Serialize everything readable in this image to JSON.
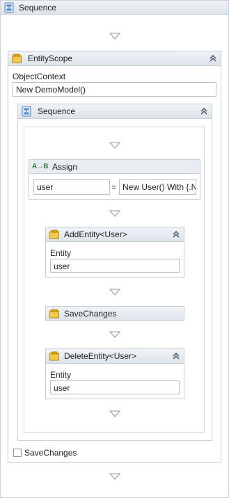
{
  "root": {
    "title": "Sequence",
    "icon": "sequence-icon"
  },
  "entity_scope": {
    "title": "EntityScope",
    "icon": "scope-icon",
    "object_context_label": "ObjectContext",
    "object_context_value": "New DemoModel()",
    "footer_checkbox_label": "SaveChanges"
  },
  "inner_sequence": {
    "title": "Sequence",
    "icon": "sequence-icon"
  },
  "assign": {
    "title": "Assign",
    "icon": "assign-icon",
    "to": "user",
    "equals": "=",
    "value": "New User() With {.N"
  },
  "add_entity": {
    "title": "AddEntity<User>",
    "entity_label": "Entity",
    "entity_value": "user"
  },
  "save_changes": {
    "title": "SaveChanges"
  },
  "delete_entity": {
    "title": "DeleteEntity<User>",
    "entity_label": "Entity",
    "entity_value": "user"
  },
  "colors": {
    "border": "#c5ced8",
    "header_top": "#f1f4f7",
    "header_bottom": "#dde4ea",
    "drop_arrow": "#8a97a3"
  }
}
